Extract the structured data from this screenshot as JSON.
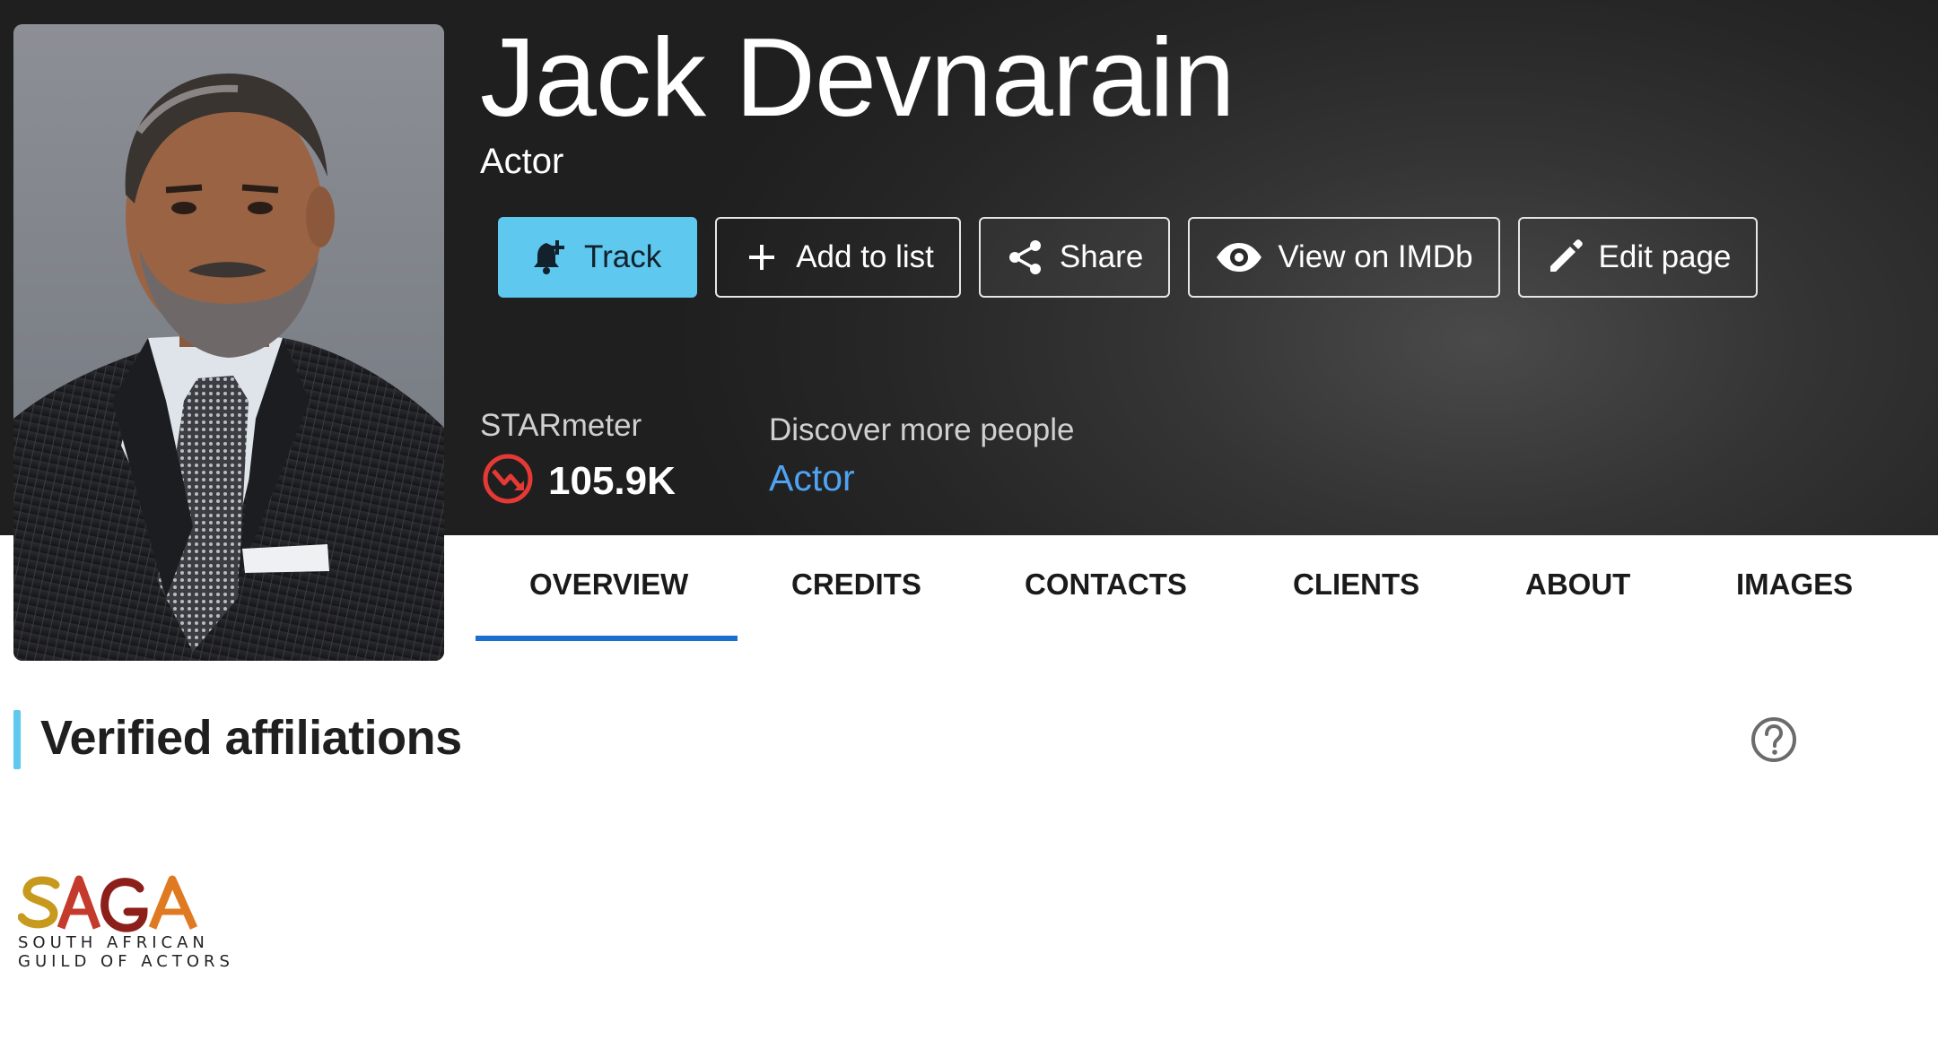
{
  "profile": {
    "name": "Jack Devnarain",
    "role": "Actor"
  },
  "actions": {
    "track": "Track",
    "add_to_list": "Add to list",
    "share": "Share",
    "view_on_imdb": "View on IMDb",
    "edit_page": "Edit page"
  },
  "starmeter": {
    "label": "STARmeter",
    "value": "105.9K",
    "trend": "down"
  },
  "discover": {
    "label": "Discover more people",
    "link": "Actor"
  },
  "tabs": [
    {
      "label": "OVERVIEW",
      "active": true
    },
    {
      "label": "CREDITS",
      "active": false
    },
    {
      "label": "CONTACTS",
      "active": false
    },
    {
      "label": "CLIENTS",
      "active": false
    },
    {
      "label": "ABOUT",
      "active": false
    },
    {
      "label": "IMAGES",
      "active": false
    }
  ],
  "affiliations": {
    "title": "Verified affiliations",
    "logo": {
      "wordmark": "SAGA",
      "line1": "SOUTH AFRICAN",
      "line2": "GUILD OF ACTORS"
    }
  },
  "colors": {
    "accent": "#5ec8ef",
    "link": "#4fa3f2",
    "tab_underline": "#1d6fcf",
    "starmeter_down": "#e53935"
  },
  "icons": {
    "track": "bell-plus-icon",
    "add": "plus-icon",
    "share": "share-icon",
    "view": "eye-icon",
    "edit": "pencil-icon",
    "starmeter": "trend-down-icon",
    "help": "question-circle-icon"
  }
}
